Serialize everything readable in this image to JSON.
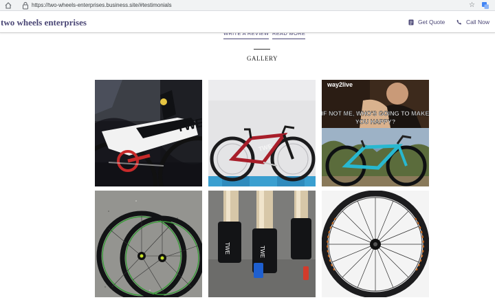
{
  "browser": {
    "url": "https://two-wheels-enterprises.business.site/#testimonials"
  },
  "header": {
    "brand": "two wheels enterprises",
    "get_quote": "Get Quote",
    "call_now": "Call Now"
  },
  "links": {
    "write_review": "WRITE A REVIEW",
    "read_more": "READ MORE"
  },
  "gallery": {
    "title": "GALLERY",
    "meme_logo": "way2live",
    "meme_text_line1": "IF NOT ME, WHO'S GOING TO MAKE",
    "meme_text_line2": "YOU HAPPY?"
  },
  "colors": {
    "accent": "#4a4675"
  }
}
